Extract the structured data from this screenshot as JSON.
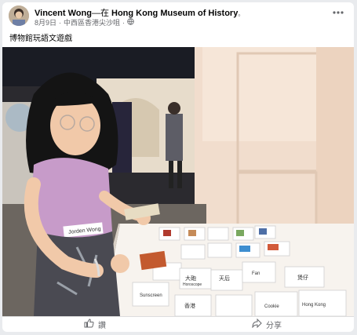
{
  "post": {
    "author_name": "Vincent Wong",
    "at_prefix": "—在 ",
    "location": "Hong Kong Museum of History",
    "separator": "。",
    "date": "8月9日",
    "place_detail": "中西區香港尖沙咀",
    "caption": "博物館玩語文遊戲"
  },
  "photo": {
    "name_tag": "Jorden Wong",
    "cards": [
      "大砲",
      "Horoscope",
      "天后",
      "Fan",
      "煲仔",
      "Cookie",
      "Sunscreen",
      "香港",
      "Hong Kong"
    ]
  },
  "actions": {
    "like_label": "讚",
    "share_label": "分享"
  }
}
